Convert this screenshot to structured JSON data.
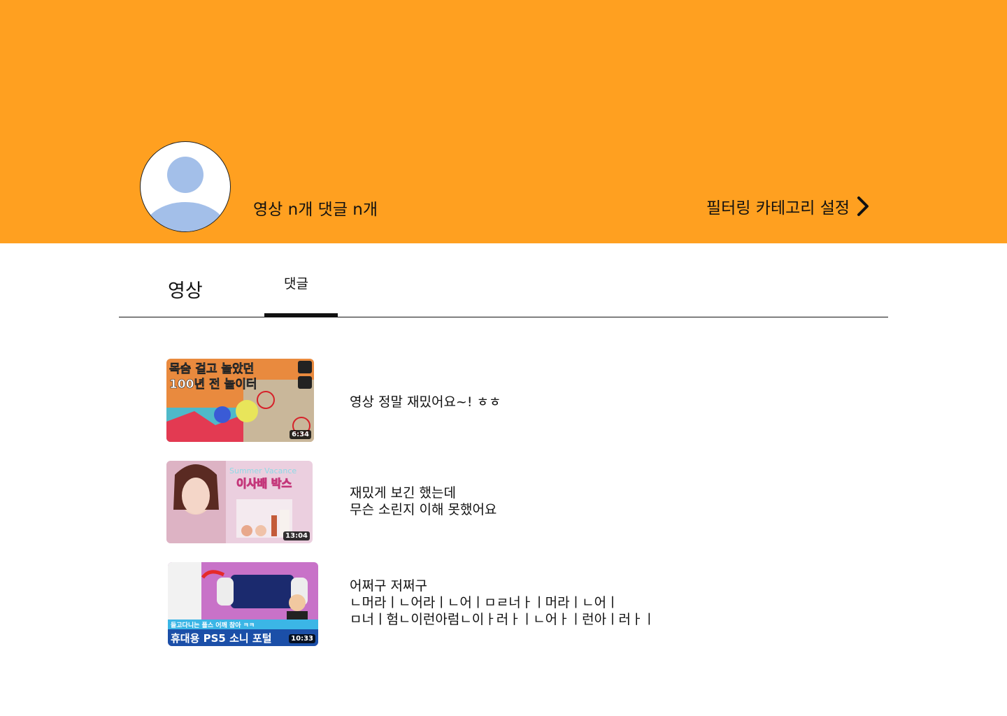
{
  "header": {
    "stats": "영상 n개 댓글 n개",
    "filter_label": "필터링 카테고리 설정",
    "banner_color": "#FFA020"
  },
  "tabs": [
    {
      "label": "영상",
      "active": false
    },
    {
      "label": "댓글",
      "active": true
    }
  ],
  "comments": [
    {
      "thumb_title_1": "목숨 걸고 놀았던",
      "thumb_title_2": "100년 전 놀이터",
      "duration": "6:34",
      "lines": [
        "영상 정말 재밌어요~! ㅎㅎ"
      ]
    },
    {
      "thumb_title_1": "Summer Vacance",
      "thumb_title_2": "이사배 박스",
      "duration": "13:04",
      "lines": [
        "재밌게 보긴 했는데",
        "무슨 소린지 이해 못했어요"
      ]
    },
    {
      "thumb_title_1": "들고다니는 플스 어깨 참아 ㅋㅋ",
      "thumb_title_2": "휴대용 PS5 소니 포털",
      "duration": "10:33",
      "lines": [
        "어쩌구 저쩌구",
        "ㄴ머라ㅣㄴ어라ㅣㄴ어ㅣㅁㄹ너ㅏㅣ머라ㅣㄴ어ㅣ",
        "ㅁ너ㅣ험ㄴ이런아럼ㄴ이ㅏ러ㅏㅣㄴ어ㅏㅣ런아ㅣ러ㅏㅣ"
      ]
    }
  ]
}
